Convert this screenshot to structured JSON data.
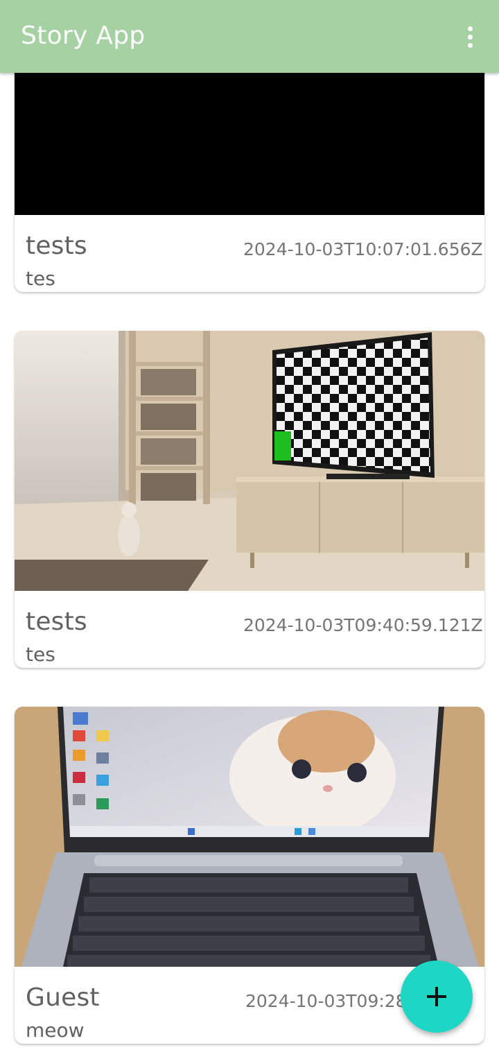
{
  "app_bar": {
    "title": "Story App",
    "menu_icon": "more-vert-icon"
  },
  "stories": [
    {
      "name": "tests",
      "date": "2024-10-03T10:07:01.656Z",
      "description": "tes",
      "image": "black-photo"
    },
    {
      "name": "tests",
      "date": "2024-10-03T09:40:59.121Z",
      "description": "tes",
      "image": "room-with-cat-and-checkerboard-tv"
    },
    {
      "name": "Guest",
      "date": "2024-10-03T09:28:1",
      "description": "meow",
      "image": "laptop-with-cat-wallpaper"
    }
  ],
  "fab": {
    "icon": "add-icon"
  },
  "colors": {
    "app_bar": "#a5d1a3",
    "fab": "#1ed6c4",
    "text": "#616161"
  }
}
